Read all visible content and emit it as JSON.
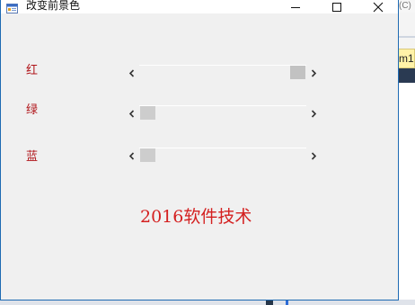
{
  "window": {
    "title": "改变前景色"
  },
  "background_window": {
    "top_text": "(C)",
    "tab_label": "m1"
  },
  "labels": {
    "red": "红",
    "green": "绿",
    "blue": "蓝"
  },
  "scrollbars": {
    "red": {
      "value_fraction": 1.0
    },
    "green": {
      "value_fraction": 0.0
    },
    "blue": {
      "value_fraction": 0.0
    }
  },
  "sample": {
    "text": "2016软件技术",
    "color": "#d42020"
  },
  "colors": {
    "label_color": "#b0151a",
    "window_border": "#1e6ab3",
    "form_background": "#f0f0f0"
  },
  "icons": {
    "app": "form-icon",
    "minimize": "minimize-icon",
    "maximize": "maximize-icon",
    "close": "close-icon",
    "scroll_left": "chevron-left-icon",
    "scroll_right": "chevron-right-icon"
  }
}
